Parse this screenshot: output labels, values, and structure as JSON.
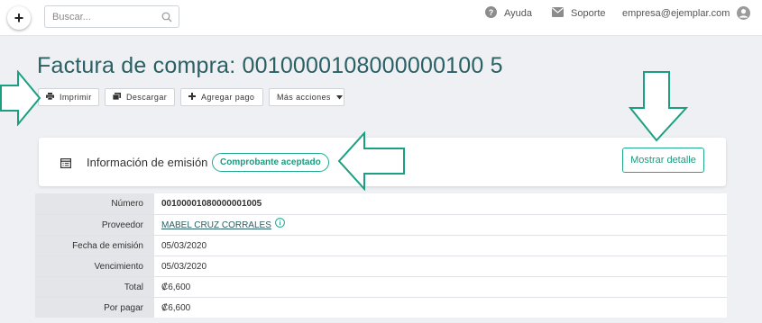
{
  "header": {
    "add_label": "+",
    "search_placeholder": "Buscar...",
    "help_label": "Ayuda",
    "support_label": "Soporte",
    "user_email": "empresa@ejemplar.com"
  },
  "page": {
    "title": "Factura de compra: 0010000108000000100 5"
  },
  "actions": {
    "print": "Imprimir",
    "download": "Descargar",
    "add_payment": "Agregar pago",
    "more": "Más acciones"
  },
  "card": {
    "title": "Información de emisión",
    "status_badge": "Comprobante aceptado",
    "detail_button": "Mostrar detalle"
  },
  "details": {
    "rows": [
      {
        "label": "Número",
        "value": "00100001080000001005"
      },
      {
        "label": "Proveedor",
        "value": "MABEL CRUZ CORRALES"
      },
      {
        "label": "Fecha de emisión",
        "value": "05/03/2020"
      },
      {
        "label": "Vencimiento",
        "value": "05/03/2020"
      },
      {
        "label": "Total",
        "value": "₡6,600"
      },
      {
        "label": "Por pagar",
        "value": "₡6,600"
      }
    ]
  },
  "colors": {
    "accent": "#1faa8e",
    "title": "#2a5f63",
    "arrow": "#1aa080"
  }
}
